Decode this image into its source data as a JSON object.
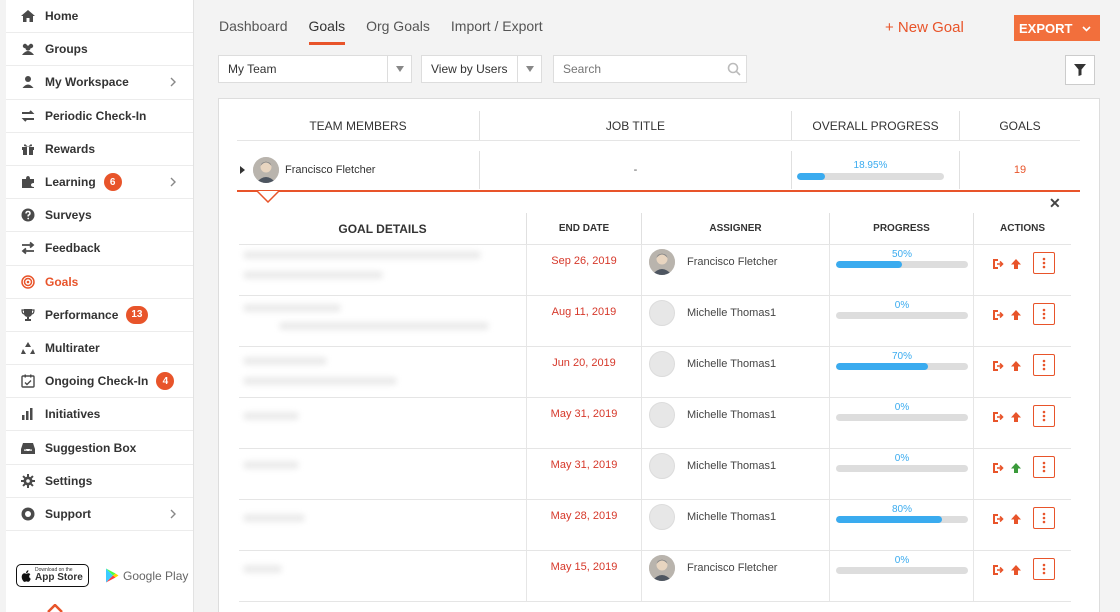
{
  "sidebar": {
    "items": [
      {
        "label": "Home",
        "icon": "home-icon"
      },
      {
        "label": "Groups",
        "icon": "users-icon"
      },
      {
        "label": "My Workspace",
        "icon": "person-icon",
        "chevron": true
      },
      {
        "label": "Periodic Check-In",
        "icon": "exchange-icon"
      },
      {
        "label": "Rewards",
        "icon": "gift-icon"
      },
      {
        "label": "Learning",
        "icon": "puzzle-icon",
        "badge": "6",
        "chevron": true
      },
      {
        "label": "Surveys",
        "icon": "question-icon"
      },
      {
        "label": "Feedback",
        "icon": "arrows-icon"
      },
      {
        "label": "Goals",
        "icon": "target-icon",
        "active": true
      },
      {
        "label": "Performance",
        "icon": "trophy-icon",
        "badge": "13"
      },
      {
        "label": "Multirater",
        "icon": "recycle-icon"
      },
      {
        "label": "Ongoing Check-In",
        "icon": "calendar-check-icon",
        "badge": "4"
      },
      {
        "label": "Initiatives",
        "icon": "bar-chart-icon"
      },
      {
        "label": "Suggestion Box",
        "icon": "inbox-icon"
      },
      {
        "label": "Settings",
        "icon": "gear-icon"
      },
      {
        "label": "Support",
        "icon": "support-icon",
        "chevron": true
      }
    ],
    "app_store": {
      "line1": "Download on the",
      "line2": "App Store"
    },
    "google_play": "Google Play"
  },
  "tabs": [
    "Dashboard",
    "Goals",
    "Org Goals",
    "Import / Export"
  ],
  "active_tab": "Goals",
  "new_goal_label": "+ New Goal",
  "export_label": "EXPORT",
  "filters": {
    "team": "My Team",
    "view": "View by Users",
    "search_placeholder": "Search"
  },
  "team_table": {
    "headers": [
      "TEAM MEMBERS",
      "JOB TITLE",
      "OVERALL PROGRESS",
      "GOALS"
    ],
    "row": {
      "name": "Francisco Fletcher",
      "job_title": "-",
      "progress_label": "18.95%",
      "progress_value": 18.95,
      "goals": "19"
    }
  },
  "goal_table": {
    "headers": [
      "GOAL DETAILS",
      "END DATE",
      "ASSIGNER",
      "PROGRESS",
      "ACTIONS"
    ],
    "rows": [
      {
        "end_date": "Sep 26, 2019",
        "assigner": "Francisco Fletcher",
        "has_photo": true,
        "progress_label": "50%",
        "progress": 50,
        "up_arrow": "orange"
      },
      {
        "end_date": "Aug 11, 2019",
        "assigner": "Michelle Thomas1",
        "has_photo": false,
        "progress_label": "0%",
        "progress": 0,
        "up_arrow": "orange"
      },
      {
        "end_date": "Jun 20, 2019",
        "assigner": "Michelle Thomas1",
        "has_photo": false,
        "progress_label": "70%",
        "progress": 70,
        "up_arrow": "orange"
      },
      {
        "end_date": "May 31, 2019",
        "assigner": "Michelle Thomas1",
        "has_photo": false,
        "progress_label": "0%",
        "progress": 0,
        "up_arrow": "orange"
      },
      {
        "end_date": "May 31, 2019",
        "assigner": "Michelle Thomas1",
        "has_photo": false,
        "progress_label": "0%",
        "progress": 0,
        "up_arrow": "green"
      },
      {
        "end_date": "May 28, 2019",
        "assigner": "Michelle Thomas1",
        "has_photo": false,
        "progress_label": "80%",
        "progress": 80,
        "up_arrow": "orange"
      },
      {
        "end_date": "May 15, 2019",
        "assigner": "Francisco Fletcher",
        "has_photo": true,
        "progress_label": "0%",
        "progress": 0,
        "up_arrow": "orange"
      }
    ]
  },
  "colors": {
    "accent": "#e8542a",
    "progress": "#3aabef",
    "date": "#d6382a",
    "green_arrow": "#3a9a3a"
  }
}
